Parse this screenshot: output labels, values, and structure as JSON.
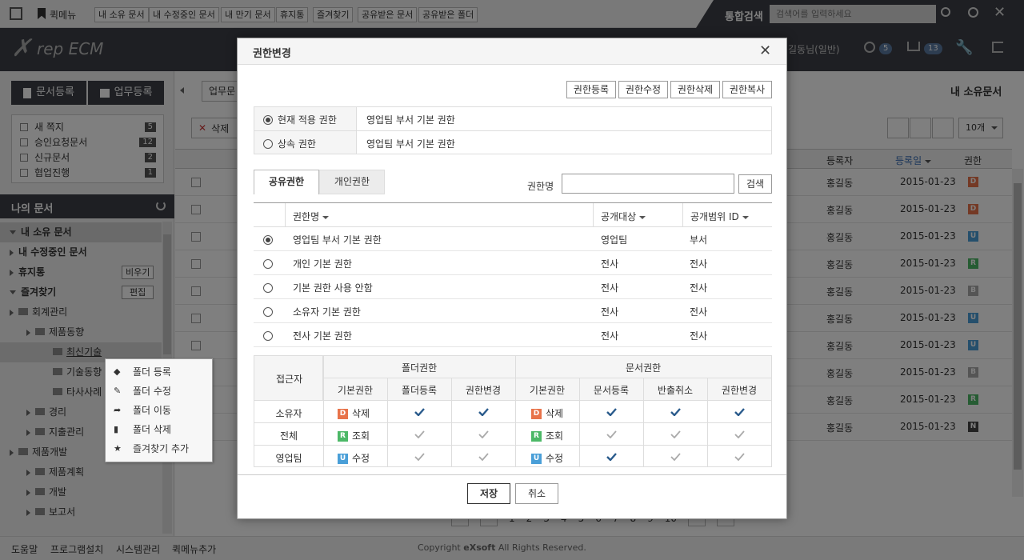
{
  "quickbar": {
    "quickmenu_label": "퀵메뉴",
    "links": [
      "내 소유 문서",
      "내 수정중인 문서",
      "내 만기 문서",
      "휴지통",
      "즐겨찾기",
      "공유받은 문서",
      "공유받은 폴더"
    ],
    "search_label": "통합검색",
    "search_placeholder": "검색어를 입력하세요"
  },
  "header": {
    "logo_text": "rep ECM",
    "user_name": "길동님(일반)",
    "badge_approval": "5",
    "badge_cart": "13"
  },
  "leftpanel": {
    "register_doc": "문서등록",
    "register_work": "업무등록",
    "notices": [
      {
        "label": "새 쪽지",
        "count": "5"
      },
      {
        "label": "승인요청문서",
        "count": "12"
      },
      {
        "label": "신규문서",
        "count": "2"
      },
      {
        "label": "협업진행",
        "count": "1"
      }
    ],
    "my_docs_title": "나의 문서",
    "tree": {
      "my_owned": "내 소유 문서",
      "my_editing": "내 수정중인 문서",
      "trash": "휴지통",
      "trash_btn": "비우기",
      "favorites": "즐겨찾기",
      "favorites_btn": "편집",
      "f1": "회계관리",
      "f1_1": "제품동향",
      "f1_1_1": "최신기술",
      "f1_1_2": "기술동향",
      "f1_1_3": "타사사례",
      "f2": "경리",
      "f3": "지출관리",
      "f4": "제품개발",
      "f4_1": "제품계획",
      "f4_2": "개발",
      "f4_3": "보고서"
    }
  },
  "context_menu": [
    "폴더 등록",
    "폴더 수정",
    "폴더 이동",
    "폴더 삭제",
    "즐겨찾기 추가"
  ],
  "main": {
    "tab_partial": "업무문",
    "delete_btn": "삭제",
    "page_title": "내 소유문서",
    "page_size": "10개",
    "col_registrant": "등록자",
    "col_date": "등록일",
    "col_perm": "권한",
    "rows": [
      {
        "registrant": "홍길동",
        "date": "2015-01-23",
        "perm": "D",
        "color": "#e8734a"
      },
      {
        "registrant": "홍길동",
        "date": "2015-01-23",
        "perm": "D",
        "color": "#e8734a"
      },
      {
        "registrant": "홍길동",
        "date": "2015-01-23",
        "perm": "U",
        "color": "#4a9fd8"
      },
      {
        "registrant": "홍길동",
        "date": "2015-01-23",
        "perm": "R",
        "color": "#4cb867"
      },
      {
        "registrant": "홍길동",
        "date": "2015-01-23",
        "perm": "B",
        "color": "#aaaaaa"
      },
      {
        "registrant": "홍길동",
        "date": "2015-01-23",
        "perm": "U",
        "color": "#4a9fd8"
      },
      {
        "registrant": "홍길동",
        "date": "2015-01-23",
        "perm": "U",
        "color": "#4a9fd8"
      },
      {
        "registrant": "홍길동",
        "date": "2015-01-23",
        "perm": "B",
        "color": "#aaaaaa"
      },
      {
        "registrant": "홍길동",
        "date": "2015-01-23",
        "perm": "R",
        "color": "#4cb867"
      },
      {
        "registrant": "홍길동",
        "date": "2015-01-23",
        "perm": "N",
        "color": "#444444"
      }
    ],
    "pages": [
      "1",
      "2",
      "3",
      "4",
      "5",
      "6",
      "7",
      "8",
      "9",
      "10"
    ]
  },
  "footer": {
    "links": [
      "도움말",
      "프로그램설치",
      "시스템관리",
      "퀵메뉴추가"
    ],
    "copyright_prefix": "Copyright",
    "copyright_brand": "eXsoft",
    "copyright_suffix": "All Rights Reserved."
  },
  "modal": {
    "title": "권한변경",
    "top_buttons": [
      "권한등록",
      "권한수정",
      "권한삭제",
      "권한복사"
    ],
    "current_label": "현재 적용 권한",
    "current_value": "영업팀 부서 기본 권한",
    "inherit_label": "상속 권한",
    "inherit_value": "영업팀 부서 기본 권한",
    "tabs": [
      "공유권한",
      "개인권한"
    ],
    "search_label": "권한명",
    "search_value": "",
    "search_btn": "검색",
    "list_headers": [
      "권한명",
      "공개대상",
      "공개범위 ID"
    ],
    "list_rows": [
      {
        "name": "영업팀 부서 기본 권한",
        "target": "영업팀",
        "scope": "부서",
        "selected": true
      },
      {
        "name": "개인 기본 권한",
        "target": "전사",
        "scope": "전사",
        "selected": false
      },
      {
        "name": "기본 권한 사용 안함",
        "target": "전사",
        "scope": "전사",
        "selected": false
      },
      {
        "name": "소유자 기본 권한",
        "target": "전사",
        "scope": "전사",
        "selected": false
      },
      {
        "name": "전사 기본 권한",
        "target": "전사",
        "scope": "전사",
        "selected": false
      }
    ],
    "perm_table": {
      "accessor_header": "접근자",
      "folder_group": "폴더권한",
      "doc_group": "문서권한",
      "sub_headers": [
        "기본권한",
        "폴더등록",
        "권한변경",
        "기본권한",
        "문서등록",
        "반출취소",
        "권한변경"
      ],
      "rows": [
        {
          "accessor": "소유자",
          "folder_badge": "D",
          "folder_badge_color": "#e8734a",
          "folder_basic": "삭제",
          "folder_reg": true,
          "folder_chg": true,
          "doc_badge": "D",
          "doc_badge_color": "#e8734a",
          "doc_basic": "삭제",
          "doc_reg": true,
          "doc_cancel": true,
          "doc_chg": true
        },
        {
          "accessor": "전체",
          "folder_badge": "R",
          "folder_badge_color": "#4cb867",
          "folder_basic": "조회",
          "folder_reg": false,
          "folder_chg": false,
          "doc_badge": "R",
          "doc_badge_color": "#4cb867",
          "doc_basic": "조회",
          "doc_reg": false,
          "doc_cancel": false,
          "doc_chg": false
        },
        {
          "accessor": "영업팀",
          "folder_badge": "U",
          "folder_badge_color": "#4a9fd8",
          "folder_basic": "수정",
          "folder_reg": false,
          "folder_chg": false,
          "doc_badge": "U",
          "doc_badge_color": "#4a9fd8",
          "doc_basic": "수정",
          "doc_reg": true,
          "doc_cancel": false,
          "doc_chg": false
        }
      ]
    },
    "save_btn": "저장",
    "cancel_btn": "취소"
  }
}
